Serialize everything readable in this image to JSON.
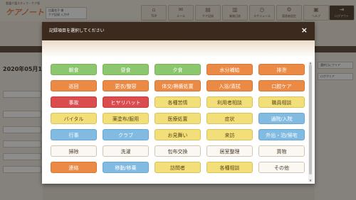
{
  "app": {
    "subtitle": "看護介護スタッフ・ケア版",
    "logo": "ケアノート",
    "user_line1": "比嘉花子 様",
    "user_line2": "ケア記録 入力中",
    "date": "2020年05月1",
    "nav": [
      {
        "label": "TOP",
        "icon": "home-icon"
      },
      {
        "label": "メール",
        "icon": "mail-icon"
      },
      {
        "label": "ケア記録",
        "icon": "chart-icon"
      },
      {
        "label": "業務日誌",
        "icon": "book-icon"
      },
      {
        "label": "スケジュール",
        "icon": "clock-icon"
      },
      {
        "label": "管理者設定",
        "icon": "gear-icon"
      },
      {
        "label": "ヘルプ",
        "icon": "printer-icon"
      },
      {
        "label": "ログアウト",
        "icon": "logout-icon"
      }
    ],
    "right_items": [
      "選択日にクリア",
      "ログクリア"
    ]
  },
  "modal": {
    "title": "記録項目を選択してください",
    "close_label": "×",
    "items": [
      {
        "label": "朝食",
        "color": "green"
      },
      {
        "label": "昼食",
        "color": "green"
      },
      {
        "label": "夕食",
        "color": "green"
      },
      {
        "label": "水分補給",
        "color": "orange"
      },
      {
        "label": "排泄",
        "color": "orange"
      },
      {
        "label": "巡回",
        "color": "orange"
      },
      {
        "label": "更衣/整容",
        "color": "orange"
      },
      {
        "label": "体交/褥瘡処置",
        "color": "orange"
      },
      {
        "label": "入浴/清拭",
        "color": "orange"
      },
      {
        "label": "口腔ケア",
        "color": "orange"
      },
      {
        "label": "事故",
        "color": "red"
      },
      {
        "label": "ヒヤリハット",
        "color": "red"
      },
      {
        "label": "各種苦情",
        "color": "yellow"
      },
      {
        "label": "利用者相談",
        "color": "yellow"
      },
      {
        "label": "職員相談",
        "color": "yellow"
      },
      {
        "label": "バイタル",
        "color": "yellow"
      },
      {
        "label": "薬塗布/服用",
        "color": "yellow"
      },
      {
        "label": "医療処置",
        "color": "yellow"
      },
      {
        "label": "症状",
        "color": "yellow"
      },
      {
        "label": "通院/入院",
        "color": "blue"
      },
      {
        "label": "行事",
        "color": "blue"
      },
      {
        "label": "クラブ",
        "color": "blue"
      },
      {
        "label": "お見舞い",
        "color": "yellow"
      },
      {
        "label": "来訪",
        "color": "yellow"
      },
      {
        "label": "外出・泊/帰宅",
        "color": "blue"
      },
      {
        "label": "掃除",
        "color": "white"
      },
      {
        "label": "洗濯",
        "color": "white"
      },
      {
        "label": "包布交換",
        "color": "white"
      },
      {
        "label": "居室整理",
        "color": "white"
      },
      {
        "label": "買物",
        "color": "white"
      },
      {
        "label": "連絡",
        "color": "orange"
      },
      {
        "label": "移動/移乗",
        "color": "blue"
      },
      {
        "label": "訪問者",
        "color": "yellow"
      },
      {
        "label": "各種相談",
        "color": "yellow"
      },
      {
        "label": "その他",
        "color": "white"
      }
    ]
  }
}
